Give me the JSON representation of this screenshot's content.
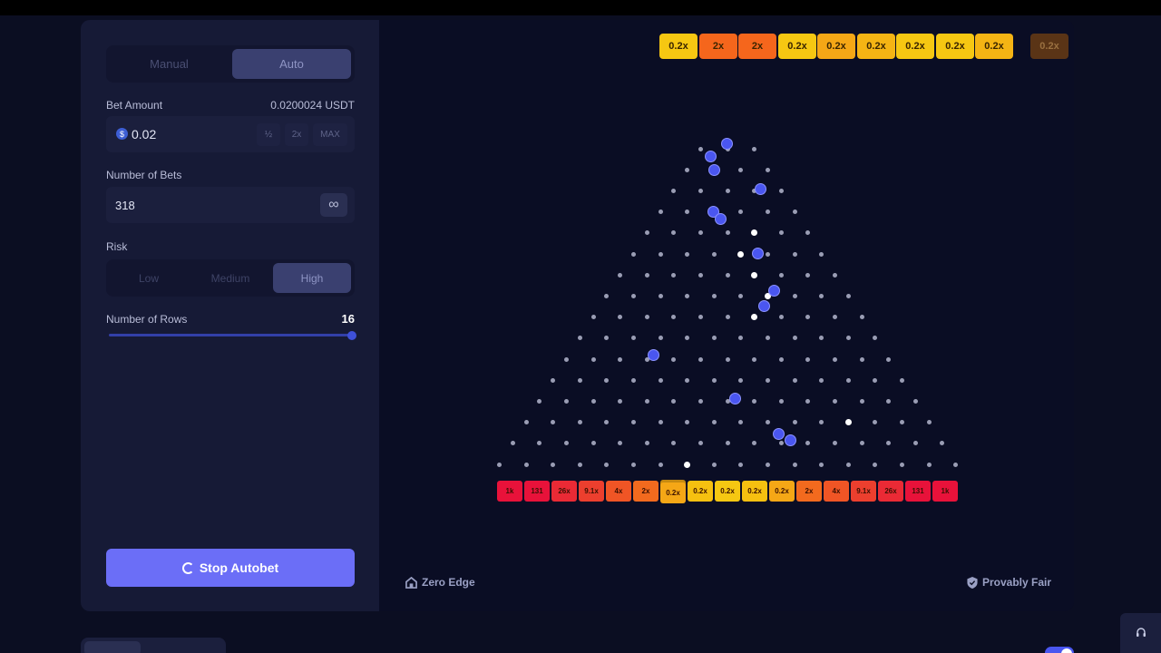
{
  "mode_tabs": {
    "manual": "Manual",
    "auto": "Auto",
    "active": "Auto"
  },
  "bet": {
    "label": "Bet Amount",
    "usd_value": "0.0200024 USDT",
    "coin_symbol": "$",
    "amount": "0.02",
    "half_label": "½",
    "double_label": "2x",
    "max_label": "MAX"
  },
  "bets": {
    "label": "Number of Bets",
    "value": "318",
    "infinite_label": "∞"
  },
  "risk": {
    "label": "Risk",
    "options": [
      "Low",
      "Medium",
      "High"
    ],
    "active": "High"
  },
  "rows": {
    "label": "Number of Rows",
    "value": "16",
    "min": 8,
    "max": 16
  },
  "stop_button": "Stop Autobet",
  "footer": {
    "zero_edge": "Zero Edge",
    "provably_fair": "Provably Fair"
  },
  "history": [
    "0.2x",
    "2x",
    "2x",
    "0.2x",
    "0.2x",
    "0.2x",
    "0.2x",
    "0.2x",
    "0.2x",
    "0.2x"
  ],
  "buckets": [
    "1k",
    "131",
    "26x",
    "9.1x",
    "4x",
    "2x",
    "0.2x",
    "0.2x",
    "0.2x",
    "0.2x",
    "0.2x",
    "2x",
    "4x",
    "9.1x",
    "26x",
    "131",
    "1k"
  ],
  "colors": {
    "accent": "#6b6ef7",
    "bucket_red": "#e8123a",
    "bucket_orange": "#f5661c",
    "bucket_yellow": "#f6c712",
    "ball": "#4a56f0"
  }
}
